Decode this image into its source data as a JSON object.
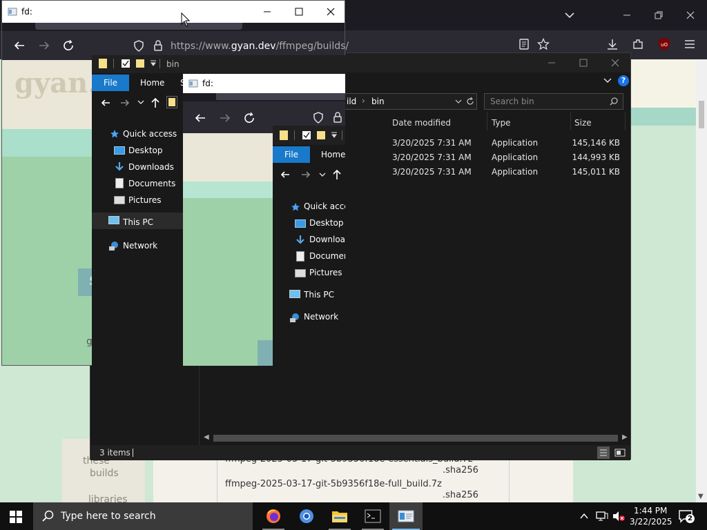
{
  "browser": {
    "url_prefix": "https://www.",
    "url_domain": "gyan.dev",
    "url_path": "/ffmpeg/builds/",
    "page_fragments": {
      "these": "these",
      "builds": "builds",
      "libraries": "libraries",
      "file1_name": "ffmpeg-2025-03-17-git-5b9356f18e-essentials_build.7z",
      "file1_ext": ".sha256",
      "file2_name": "ffmpeg-2025-03-17-git-5b9356f18e-full_build.7z",
      "file2_ext": ".sha256",
      "brand_partial": "gyan.",
      "letter_s": "S",
      "letter_g": "g"
    }
  },
  "explorer_main": {
    "breadcrumb_partial": "ild",
    "breadcrumb_current": "bin",
    "search_placeholder": "Search bin",
    "columns": {
      "date": "Date modified",
      "type": "Type",
      "size": "Size"
    },
    "rows": [
      {
        "date": "3/20/2025 7:31 AM",
        "type": "Application",
        "size": "145,146 KB"
      },
      {
        "date": "3/20/2025 7:31 AM",
        "type": "Application",
        "size": "144,993 KB"
      },
      {
        "date": "3/20/2025 7:31 AM",
        "type": "Application",
        "size": "145,011 KB"
      }
    ],
    "status": "3 items"
  },
  "window_fd_outer": {
    "title": "fd:"
  },
  "window_fd_inner": {
    "title": "fd:"
  },
  "explorer_mid": {
    "title": "bin",
    "tab_file": "File",
    "tab_home": "Home",
    "tab_share_partial": "S",
    "nav": {
      "quick_access": "Quick access",
      "desktop": "Desktop",
      "downloads": "Downloads",
      "documents": "Documents",
      "pictures": "Pictures",
      "this_pc": "This PC",
      "network": "Network"
    }
  },
  "explorer_small": {
    "tab_file": "File",
    "tab_home": "Home",
    "nav": {
      "quick_access": "Quick acces",
      "desktop": "Desktop",
      "downloads": "Download",
      "documents": "Documen",
      "pictures": "Pictures",
      "this_pc": "This PC",
      "network": "Network"
    }
  },
  "taskbar": {
    "search_placeholder": "Type here to search",
    "time": "1:44 PM",
    "date": "3/22/2025",
    "notification_count": "2"
  }
}
